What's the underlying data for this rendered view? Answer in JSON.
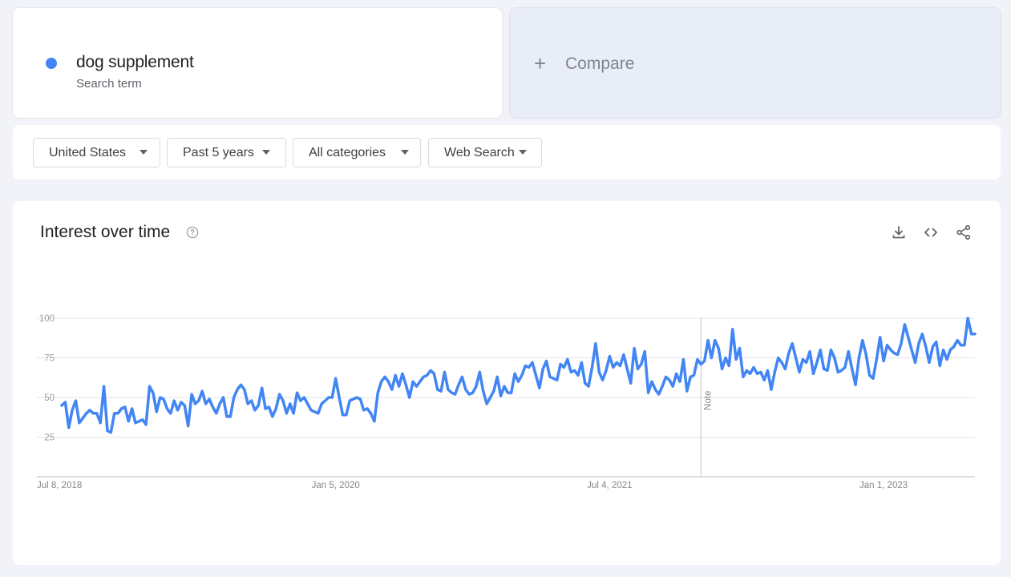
{
  "search_term": {
    "name": "dog supplement",
    "subtitle": "Search term",
    "color": "#4285f4"
  },
  "compare": {
    "plus": "+",
    "label": "Compare"
  },
  "filters": [
    {
      "label": "United States",
      "icon": "caret-down-icon"
    },
    {
      "label": "Past 5 years",
      "icon": "caret-down-icon"
    },
    {
      "label": "All categories",
      "icon": "caret-down-icon"
    },
    {
      "label": "Web Search",
      "icon": "caret-down-icon"
    }
  ],
  "interest_panel": {
    "title": "Interest over time",
    "help_icon": "help-circle-icon",
    "tools": [
      "download-icon",
      "embed-code-icon",
      "share-icon"
    ],
    "note_label": "Note"
  },
  "chart_data": {
    "type": "line",
    "title": "Interest over time",
    "xlabel": "",
    "ylabel": "",
    "ylim": [
      0,
      100
    ],
    "yticks": [
      25,
      50,
      75,
      100
    ],
    "grid": true,
    "line_color": "#4285f4",
    "x_tick_labels": [
      "Jul 8, 2018",
      "Jan 5, 2020",
      "Jul 4, 2021",
      "Jan 1, 2023"
    ],
    "x_range": [
      "2018-07-08",
      "2023-07-02"
    ],
    "note_date": "2022-01-02",
    "series": [
      {
        "start": "2018-07-08",
        "interval": "week",
        "values": [
          45,
          47,
          31,
          42,
          48,
          34,
          37,
          40,
          42,
          40,
          40,
          34,
          57,
          29,
          28,
          40,
          40,
          43,
          44,
          35,
          43,
          34,
          35,
          36,
          33,
          57,
          53,
          41,
          50,
          49,
          43,
          40,
          48,
          42,
          47,
          45,
          32,
          52,
          46,
          48,
          54,
          46,
          49,
          44,
          40,
          46,
          50,
          38,
          38,
          50,
          55,
          58,
          55,
          46,
          48,
          42,
          45,
          56,
          43,
          44,
          38,
          43,
          52,
          48,
          40,
          46,
          40,
          53,
          48,
          50,
          46,
          42,
          41,
          40,
          46,
          48,
          50,
          50,
          62,
          50,
          39,
          39,
          48,
          49,
          50,
          49,
          42,
          43,
          40,
          35,
          53,
          60,
          63,
          60,
          55,
          64,
          57,
          65,
          58,
          50,
          60,
          57,
          60,
          63,
          64,
          67,
          65,
          55,
          54,
          66,
          55,
          53,
          52,
          58,
          63,
          55,
          52,
          53,
          57,
          66,
          54,
          46,
          50,
          54,
          63,
          51,
          57,
          53,
          53,
          65,
          60,
          64,
          70,
          69,
          72,
          64,
          56,
          68,
          73,
          63,
          62,
          61,
          71,
          69,
          74,
          66,
          67,
          64,
          72,
          59,
          57,
          69,
          84,
          66,
          61,
          67,
          76,
          69,
          72,
          70,
          77,
          68,
          59,
          81,
          68,
          71,
          79,
          53,
          60,
          55,
          52,
          57,
          63,
          61,
          57,
          65,
          60,
          74,
          54,
          63,
          64,
          74,
          71,
          73,
          86,
          75,
          86,
          81,
          68,
          75,
          70,
          93,
          74,
          81,
          63,
          67,
          65,
          69,
          65,
          66,
          61,
          67,
          55,
          66,
          75,
          72,
          68,
          78,
          84,
          75,
          66,
          74,
          72,
          79,
          65,
          72,
          80,
          68,
          67,
          80,
          75,
          66,
          67,
          69,
          79,
          68,
          58,
          75,
          86,
          77,
          64,
          62,
          74,
          88,
          73,
          83,
          80,
          78,
          77,
          84,
          96,
          88,
          80,
          72,
          84,
          90,
          82,
          72,
          82,
          85,
          70,
          80,
          74,
          80,
          82,
          86,
          83,
          83,
          100,
          90,
          90
        ]
      }
    ]
  }
}
